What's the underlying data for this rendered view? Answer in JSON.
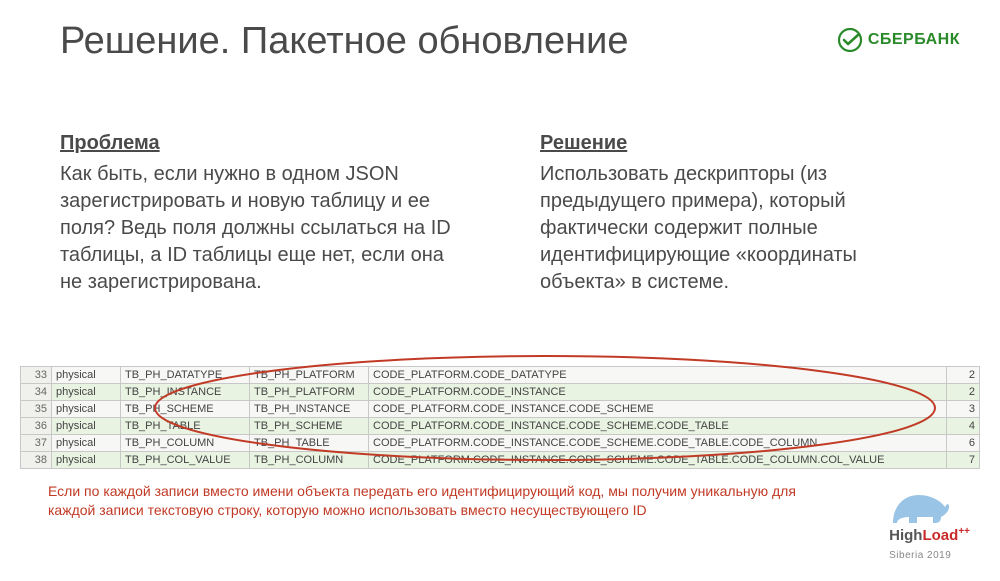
{
  "slide": {
    "title": "Решение. Пакетное обновление"
  },
  "brand": {
    "name": "СБЕРБАНК"
  },
  "problem": {
    "heading": "Проблема",
    "body": "Как быть, если нужно в одном JSON зарегистрировать и новую таблицу и ее поля? Ведь поля должны ссылаться на ID таблицы, а ID таблицы еще нет, если она не зарегистрирована."
  },
  "solution": {
    "heading": "Решение",
    "body": "Использовать дескрипторы (из предыдущего примера), который фактически содержит полные идентифицирующие «координаты объекта» в системе."
  },
  "table": {
    "rows": [
      {
        "n": "33",
        "kind": "physical",
        "t1": "TB_PH_DATATYPE",
        "t2": "TB_PH_PLATFORM",
        "path": "CODE_PLATFORM.CODE_DATATYPE",
        "depth": "2"
      },
      {
        "n": "34",
        "kind": "physical",
        "t1": "TB_PH_INSTANCE",
        "t2": "TB_PH_PLATFORM",
        "path": "CODE_PLATFORM.CODE_INSTANCE",
        "depth": "2"
      },
      {
        "n": "35",
        "kind": "physical",
        "t1": "TB_PH_SCHEME",
        "t2": "TB_PH_INSTANCE",
        "path": "CODE_PLATFORM.CODE_INSTANCE.CODE_SCHEME",
        "depth": "3"
      },
      {
        "n": "36",
        "kind": "physical",
        "t1": "TB_PH_TABLE",
        "t2": "TB_PH_SCHEME",
        "path": "CODE_PLATFORM.CODE_INSTANCE.CODE_SCHEME.CODE_TABLE",
        "depth": "4"
      },
      {
        "n": "37",
        "kind": "physical",
        "t1": "TB_PH_COLUMN",
        "t2": "TB_PH_TABLE",
        "path": "CODE_PLATFORM.CODE_INSTANCE.CODE_SCHEME.CODE_TABLE.CODE_COLUMN",
        "depth": "6"
      },
      {
        "n": "38",
        "kind": "physical",
        "t1": "TB_PH_COL_VALUE",
        "t2": "TB_PH_COLUMN",
        "path": "CODE_PLATFORM.CODE_INSTANCE.CODE_SCHEME.CODE_TABLE.CODE_COLUMN.COL_VALUE",
        "depth": "7"
      }
    ]
  },
  "footnote": "Если по каждой записи вместо имени объекта передать его идентифицирующий код, мы получим уникальную для каждой записи текстовую строку, которую можно использовать вместо несуществующего ID",
  "conference": {
    "name_pre": "High",
    "name_post": "Load",
    "plus": "++",
    "edition": "Siberia 2019"
  }
}
